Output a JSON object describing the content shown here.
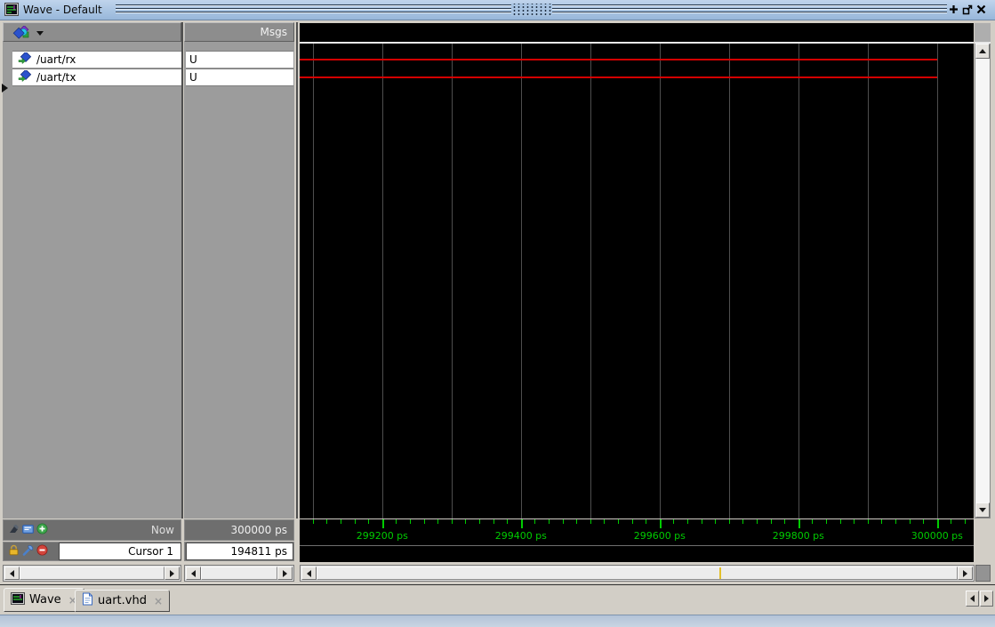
{
  "titlebar": {
    "title": "Wave - Default"
  },
  "header": {
    "msgs": "Msgs"
  },
  "signals": [
    {
      "name": "/uart/rx",
      "value": "U"
    },
    {
      "name": "/uart/tx",
      "value": "U"
    }
  ],
  "status": {
    "now_label": "Now",
    "now_value": "300000 ps",
    "cursor_label": "Cursor 1",
    "cursor_value": "194811 ps"
  },
  "tabs": {
    "items": [
      {
        "label": "Wave",
        "close": "×",
        "active": true
      },
      {
        "label": "uart.vhd",
        "close": "×",
        "active": false
      }
    ]
  },
  "icons": {
    "titlebar": [
      "wave-window-icon",
      "dock-icon",
      "undock-icon",
      "close-icon"
    ],
    "wave_toolbar": "signal-group-icon",
    "signal_rows": "signal-diamond-icon",
    "now_row": [
      "select-tool-icon",
      "window-icon",
      "add-cursor-icon"
    ],
    "cursor_row": [
      "lock-cursor-icon",
      "edit-cursor-icon",
      "delete-cursor-icon"
    ],
    "tabs": [
      "wave-tab-icon",
      "document-icon"
    ]
  },
  "chart_data": {
    "type": "waveform",
    "title": "Wave - Default",
    "time_unit": "ps",
    "visible_range_ps": [
      299081,
      300052
    ],
    "sim_end_ps": 300000,
    "gridline_step_ps": 100,
    "minor_tick_step_ps": 20,
    "major_tick_step_ps": 200,
    "major_tick_values": [
      299200,
      299400,
      299600,
      299800,
      300000
    ],
    "major_tick_labels": [
      "299200 ps",
      "299400 ps",
      "299600 ps",
      "299800 ps",
      "300000 ps"
    ],
    "now_ps": 300000,
    "cursor1_ps": 194811,
    "signals": [
      {
        "name": "/uart/rx",
        "value": "U",
        "display": "unknown-line"
      },
      {
        "name": "/uart/tx",
        "value": "U",
        "display": "unknown-line"
      }
    ],
    "colors": {
      "background": "#000000",
      "grid": "#4e4e4e",
      "unknown": "#d40000",
      "ticks": "#00cc00",
      "cursor_marker": "#e3c02a"
    },
    "legend": "none",
    "grid": true
  }
}
